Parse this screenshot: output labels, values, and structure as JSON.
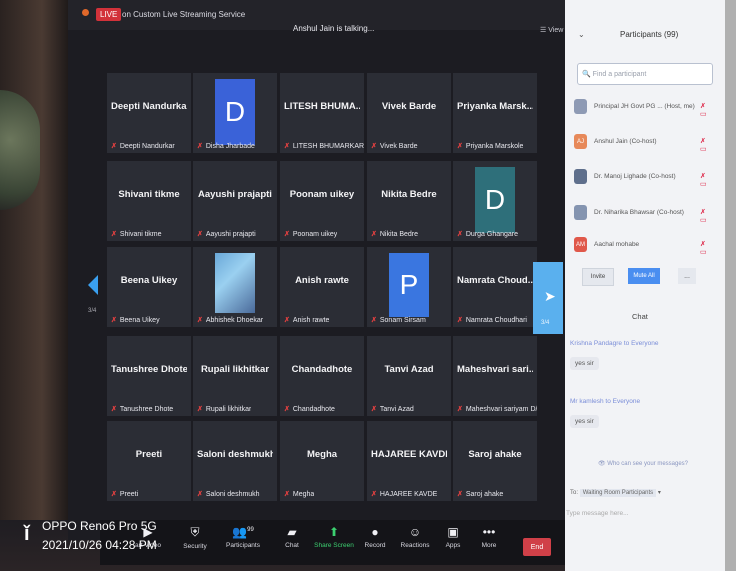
{
  "top_bar": {
    "live_badge": "LIVE",
    "stream_label": "on Custom Live Streaming Service",
    "talking_text": "Anshul Jain is talking...",
    "view_label": "View"
  },
  "gallery": {
    "page_left": "3/4",
    "page_right": "3/4",
    "tiles": [
      {
        "name": "Deepti Nandurkar",
        "sub": "Deepti Nandurkar",
        "avatar": ""
      },
      {
        "name": "",
        "sub": "Disha Jharbade",
        "avatar": "D"
      },
      {
        "name": "LITESH BHUMA...",
        "sub": "LITESH BHUMARKAR",
        "avatar": ""
      },
      {
        "name": "Vivek Barde",
        "sub": "Vivek Barde",
        "avatar": ""
      },
      {
        "name": "Priyanka Marsk...",
        "sub": "Priyanka Marskole",
        "avatar": ""
      },
      {
        "name": "Shivani tikme",
        "sub": "Shivani tikme",
        "avatar": ""
      },
      {
        "name": "Aayushi prajapti",
        "sub": "Aayushi prajapti",
        "avatar": ""
      },
      {
        "name": "Poonam uikey",
        "sub": "Poonam uikey",
        "avatar": ""
      },
      {
        "name": "Nikita Bedre",
        "sub": "Nikita Bedre",
        "avatar": ""
      },
      {
        "name": "",
        "sub": "Durga Ghangare",
        "avatar": "D"
      },
      {
        "name": "Beena Uikey",
        "sub": "Beena Uikey",
        "avatar": ""
      },
      {
        "name": "",
        "sub": "Abhishek Dhoekar",
        "avatar": "image"
      },
      {
        "name": "Anish rawte",
        "sub": "Anish rawte",
        "avatar": ""
      },
      {
        "name": "",
        "sub": "Sonam Sirsam",
        "avatar": "P"
      },
      {
        "name": "Namrata Choud...",
        "sub": "Namrata Choudhari",
        "avatar": ""
      },
      {
        "name": "Tanushree Dhote",
        "sub": "Tanushree Dhote",
        "avatar": ""
      },
      {
        "name": "Rupali likhitkar",
        "sub": "Rupali likhitkar",
        "avatar": ""
      },
      {
        "name": "Chandadhote",
        "sub": "Chandadhote",
        "avatar": ""
      },
      {
        "name": "Tanvi Azad",
        "sub": "Tanvi Azad",
        "avatar": ""
      },
      {
        "name": "Maheshvari sari...",
        "sub": "Maheshvari sariyam D/...",
        "avatar": ""
      },
      {
        "name": "Preeti",
        "sub": "Preeti",
        "avatar": ""
      },
      {
        "name": "Saloni deshmukh",
        "sub": "Saloni deshmukh",
        "avatar": ""
      },
      {
        "name": "Megha",
        "sub": "Megha",
        "avatar": ""
      },
      {
        "name": "HAJAREE KAVDE",
        "sub": "HAJAREE KAVDE",
        "avatar": ""
      },
      {
        "name": "Saroj ahake",
        "sub": "Saroj ahake",
        "avatar": ""
      }
    ]
  },
  "toolbar": {
    "items": [
      {
        "label": "art Video",
        "icon": "video-icon"
      },
      {
        "label": "Security",
        "icon": "shield-icon"
      },
      {
        "label": "Participants",
        "icon": "participants-icon",
        "count": "99"
      },
      {
        "label": "Chat",
        "icon": "chat-icon"
      },
      {
        "label": "Share Screen",
        "icon": "share-screen-icon"
      },
      {
        "label": "Record",
        "icon": "record-icon"
      },
      {
        "label": "Reactions",
        "icon": "reactions-icon"
      },
      {
        "label": "Apps",
        "icon": "apps-icon"
      },
      {
        "label": "More",
        "icon": "more-icon"
      }
    ],
    "end_label": "End"
  },
  "watermark": {
    "line1": "OPPO Reno6 Pro 5G",
    "line2": "2021/10/26 04:28 PM"
  },
  "participants_panel": {
    "title": "Participants (99)",
    "search_placeholder": "Find a participant",
    "participants": [
      {
        "name": "Principal JH Govt PG ... (Host, me)",
        "avatar": ""
      },
      {
        "name": "Anshul Jain (Co-host)",
        "avatar": "AJ"
      },
      {
        "name": "Dr. Manoj Lighade (Co-host)",
        "avatar": ""
      },
      {
        "name": "Dr. Niharika Bhawsar (Co-host)",
        "avatar": ""
      },
      {
        "name": "Aachal mohabe",
        "avatar": "AM"
      }
    ],
    "invite_label": "Invite",
    "mute_all_label": "Mute All",
    "more_label": "..."
  },
  "chat": {
    "title": "Chat",
    "messages": [
      {
        "from": "Krishna Pandagre to Everyone",
        "text": "yes sir"
      },
      {
        "from": "Mr kamlesh to Everyone",
        "text": "yes sir"
      }
    ],
    "who_see": "Who can see your messages?",
    "to_label": "To:",
    "to_value": "Waiting Room Participants",
    "input_placeholder": "Type message here..."
  },
  "colors": {
    "live": "#d2323a",
    "share_screen": "#3cd070",
    "end": "#d04048",
    "mute_all": "#4a8ef0",
    "mic_muted": "#e04040"
  }
}
